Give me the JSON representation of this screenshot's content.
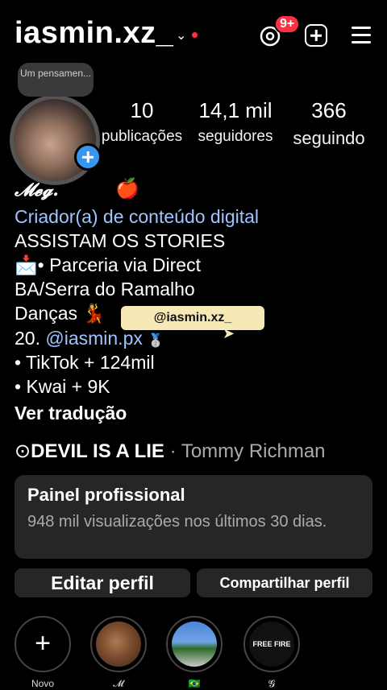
{
  "header": {
    "username": "iasmin.xz_",
    "notification_badge": "9+",
    "accent_red": "#ff3040"
  },
  "profile": {
    "note": "Um pensamen...",
    "stats": [
      {
        "value": "10",
        "label": "publicações"
      },
      {
        "value": "14,1 mil",
        "label": "seguidores"
      },
      {
        "value": "366",
        "label": "seguindo"
      }
    ]
  },
  "bio": {
    "name": "𝓜𝓮𝓰.",
    "apple": "🍎",
    "category": "Criador(a) de conteúdo digital",
    "lines": [
      "ASSISTAM OS STORIES",
      "📩• Parceria via Direct",
      "BA/Serra do Ramalho",
      "Danças  💃",
      "20.",
      "• TikTok + 124mil",
      "•  Kwai   + 9K"
    ],
    "link_handle": "@iasmin.px",
    "medal": "🥈",
    "mention_sticker": "@iasmin.xz_",
    "translate": "Ver tradução"
  },
  "music": {
    "song": "DEVIL IS A LIE",
    "artist": "· Tommy Richman"
  },
  "dashboard": {
    "title": "Painel profissional",
    "subtitle": "948 mil visualizações nos últimos 30 dias."
  },
  "buttons": {
    "edit": "Editar perfil",
    "share": "Compartilhar perfil"
  },
  "highlights": [
    {
      "label": "Novo",
      "icon": "plus-icon"
    },
    {
      "label": "𝓜",
      "icon": "photo"
    },
    {
      "label": "🇧🇷",
      "icon": "photo"
    },
    {
      "label": "𝓖",
      "icon": "free-fire-logo",
      "text": "FREE FIRE"
    }
  ]
}
